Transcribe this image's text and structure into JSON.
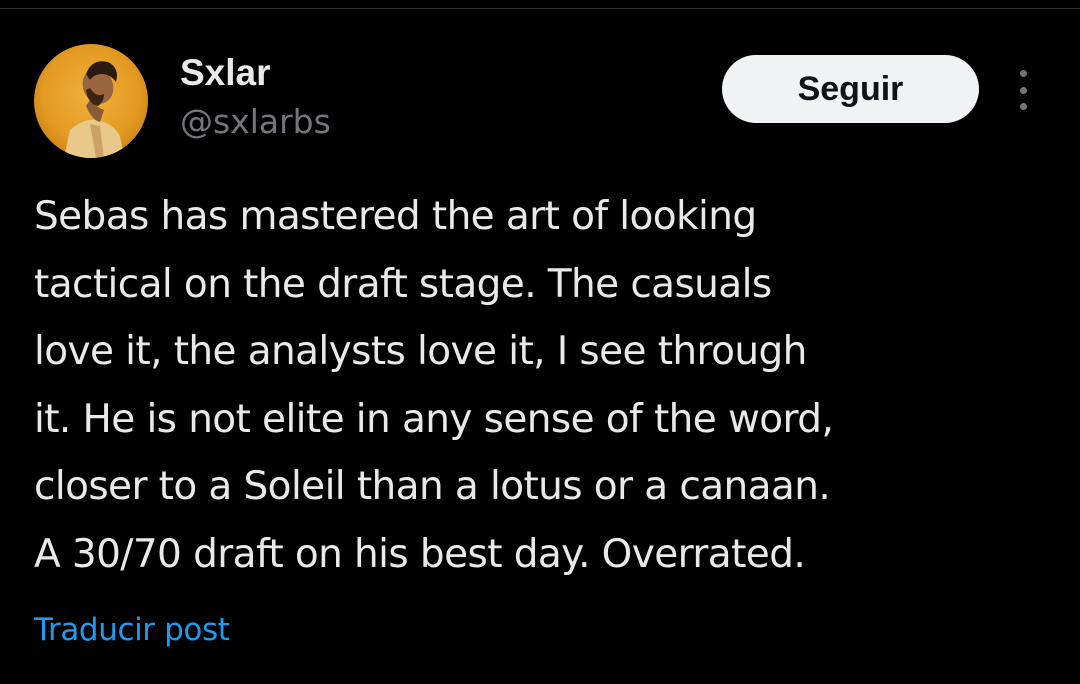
{
  "author": {
    "display_name": "Sxlar",
    "handle": "@sxlarbs",
    "avatar": "avatar-photo"
  },
  "header": {
    "follow_label": "Seguir",
    "more_icon": "more-vertical-icon"
  },
  "post": {
    "lines": [
      "Sebas has mastered the art of looking",
      "tactical on the draft stage. The casuals",
      "love it, the analysts love it, I see through",
      "it. He is not elite in any sense of the word,",
      "closer to a Soleil than a lotus or a canaan.",
      "A 30/70 draft on his best day. Overrated."
    ],
    "translate_label": "Traducir post"
  },
  "colors": {
    "background": "#000000",
    "text_primary": "#e7e9ea",
    "text_secondary": "#71767b",
    "link": "#1d9bf0",
    "button_bg": "#eff3f4",
    "button_text": "#0f1419"
  }
}
